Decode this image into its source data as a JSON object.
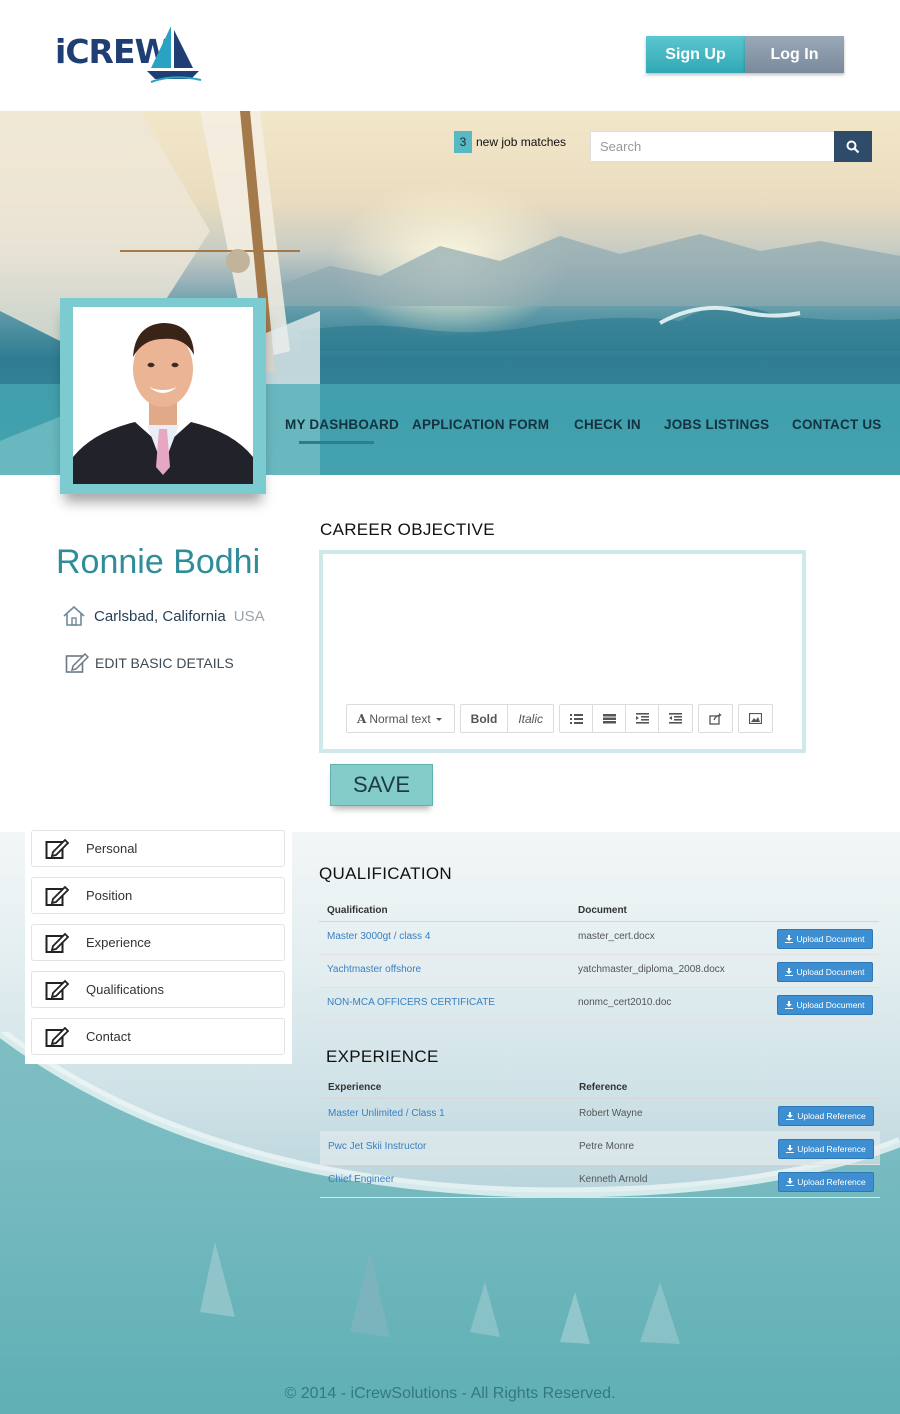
{
  "header": {
    "logo_i": "i",
    "logo_crew": "CREW",
    "signup_label": "Sign Up",
    "login_label": "Log In"
  },
  "hero": {
    "job_match_count": "3",
    "job_match_text": "new job matches",
    "search_placeholder": "Search"
  },
  "nav": {
    "items": [
      {
        "label": "MY DASHBOARD"
      },
      {
        "label": "APPLICATION FORM"
      },
      {
        "label": "CHECK IN"
      },
      {
        "label": "JOBS LISTINGS"
      },
      {
        "label": "CONTACT US"
      }
    ],
    "active": "MY DASHBOARD"
  },
  "profile": {
    "name": "Ronnie Bodhi",
    "city": "Carlsbad, California",
    "country": "USA",
    "edit_label": "EDIT BASIC DETAILS"
  },
  "career": {
    "title": "CAREER OBJECTIVE",
    "value": "",
    "toolbar": {
      "text_style": "Normal text",
      "bold": "Bold",
      "italic": "Italic"
    },
    "save_label": "SAVE"
  },
  "sidebar": {
    "items": [
      {
        "label": "Personal"
      },
      {
        "label": "Position"
      },
      {
        "label": "Experience"
      },
      {
        "label": "Qualifications"
      },
      {
        "label": "Contact"
      }
    ]
  },
  "qualification": {
    "title": "QUALIFICATION",
    "columns": [
      "Qualification",
      "Document"
    ],
    "rows": [
      {
        "name": "Master 3000gt / class 4",
        "doc": "master_cert.docx",
        "action": "Upload Document"
      },
      {
        "name": "Yachtmaster offshore",
        "doc": "yatchmaster_diploma_2008.docx",
        "action": "Upload Document"
      },
      {
        "name": "NON-MCA OFFICERS CERTIFICATE",
        "doc": "nonmc_cert2010.doc",
        "action": "Upload Document"
      }
    ]
  },
  "experience": {
    "title": "EXPERIENCE",
    "columns": [
      "Experience",
      "Reference"
    ],
    "rows": [
      {
        "name": "Master Unlimited / Class 1",
        "ref": "Robert Wayne",
        "action": "Upload Reference"
      },
      {
        "name": "Pwc Jet Skii Instructor",
        "ref": "Petre Monre",
        "action": "Upload Reference"
      },
      {
        "name": "Chief Engineer",
        "ref": "Kenneth Arnold",
        "action": "Upload Reference"
      }
    ]
  },
  "footer": {
    "text": "© 2014 - iCrewSolutions - All Rights Reserved."
  },
  "colors": {
    "accent": "#2f8d99",
    "signup": "#3db4bf",
    "login": "#8494a6",
    "upload": "#3d8fd1",
    "link": "#3a7fc1"
  },
  "icons": [
    "sailboat-logo-icon",
    "search-icon",
    "home-icon",
    "edit-icon",
    "list-ul-icon",
    "list-ol-icon",
    "indent-icon",
    "outdent-icon",
    "share-icon",
    "image-icon",
    "download-icon"
  ]
}
